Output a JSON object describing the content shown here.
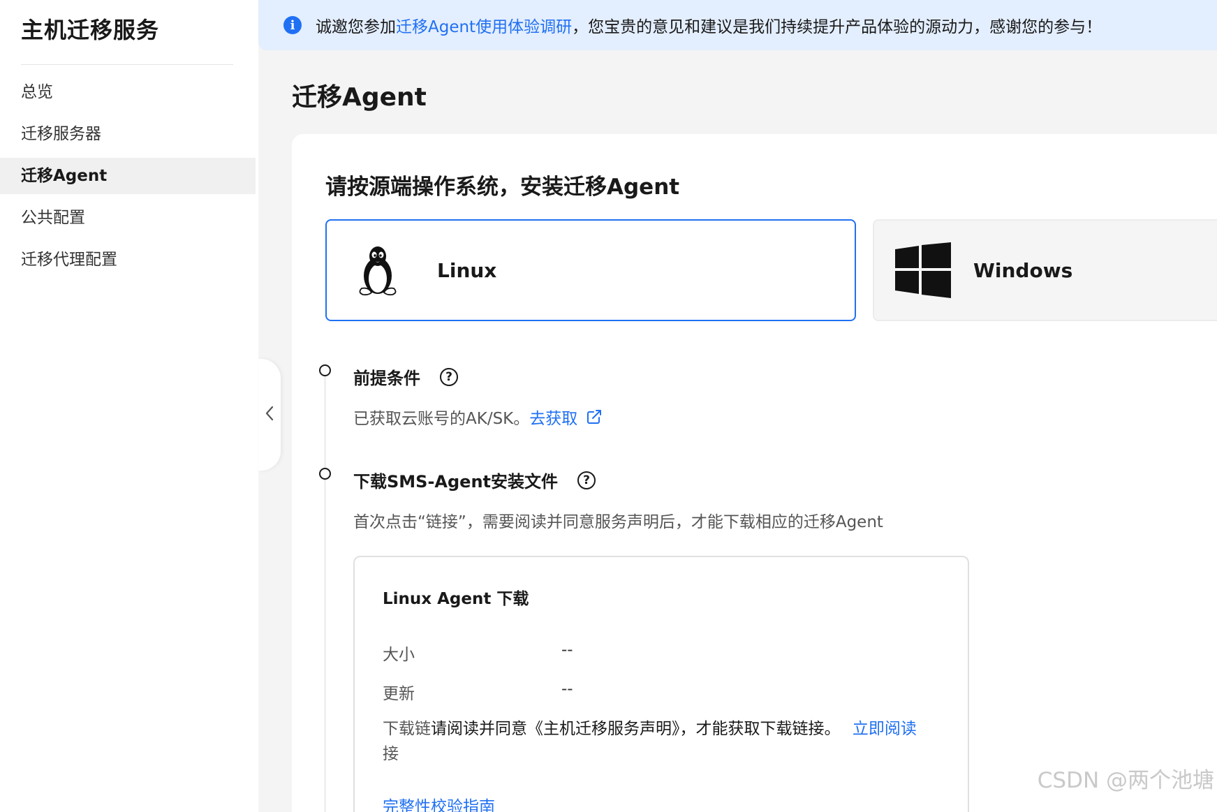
{
  "sidebar": {
    "app_title": "主机迁移服务",
    "items": [
      {
        "label": "总览"
      },
      {
        "label": "迁移服务器"
      },
      {
        "label": "迁移Agent"
      },
      {
        "label": "公共配置"
      },
      {
        "label": "迁移代理配置"
      }
    ],
    "active_index": 2
  },
  "banner": {
    "icon": "info-icon",
    "text_before": "诚邀您参加",
    "link": "迁移Agent使用体验调研",
    "text_after": "，您宝贵的意见和建议是我们持续提升产品体验的源动力，感谢您的参与！"
  },
  "page": {
    "title": "迁移Agent"
  },
  "install": {
    "title": "请按源端操作系统，安装迁移Agent",
    "os_options": [
      {
        "label": "Linux",
        "icon": "linux-penguin-icon",
        "selected": true
      },
      {
        "label": "Windows",
        "icon": "windows-logo-icon",
        "selected": false
      }
    ]
  },
  "steps": [
    {
      "title": "前提条件",
      "desc": "已获取云账号的AK/SK。",
      "link": "去获取"
    },
    {
      "title": "下载SMS-Agent安装文件",
      "desc": "首次点击“链接”，需要阅读并同意服务声明后，才能下载相应的迁移Agent"
    }
  ],
  "download": {
    "title": "Linux Agent 下载",
    "size_label": "大小",
    "size_value": "--",
    "updated_label": "更新",
    "updated_value": "--",
    "link_label": "下载链",
    "link_notice": "请阅读并同意《主机迁移服务声明》，才能获取下载链接。",
    "read_now": "立即阅读",
    "link_label_tail": "接",
    "guide": "完整性校验指南"
  },
  "watermark": "CSDN @两个池塘",
  "colors": {
    "accent": "#2070f3",
    "banner_bg": "#e3eefe",
    "page_bg": "#f4f4f4"
  }
}
